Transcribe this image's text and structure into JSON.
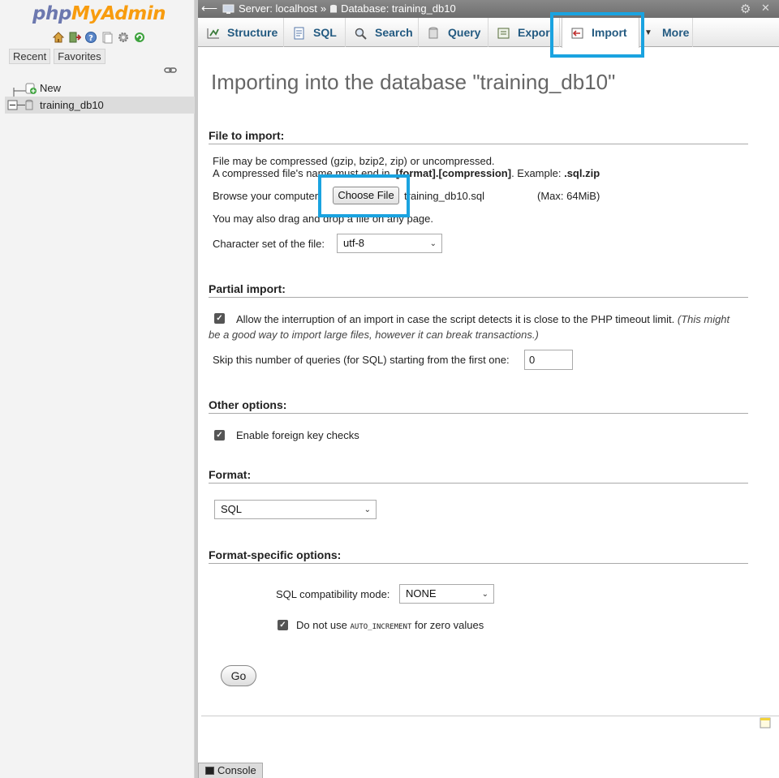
{
  "nav": {
    "logo": {
      "php": "php",
      "my": "My",
      "admin": "Admin"
    },
    "icons": [
      "home-icon",
      "logout-icon",
      "help-icon",
      "docs-icon",
      "settings-icon",
      "reload-icon"
    ],
    "tabs": [
      "Recent",
      "Favorites"
    ],
    "tree": [
      {
        "label": "New"
      },
      {
        "label": "training_db10"
      }
    ]
  },
  "breadcrumb": {
    "server": "Server: localhost",
    "separator": "»",
    "database": "Database: training_db10"
  },
  "menu": {
    "tabs": [
      {
        "label": "Structure",
        "icon": "structure-icon"
      },
      {
        "label": "SQL",
        "icon": "sql-icon"
      },
      {
        "label": "Search",
        "icon": "search-icon"
      },
      {
        "label": "Query",
        "icon": "query-icon"
      },
      {
        "label": "Expor",
        "icon": "export-icon"
      },
      {
        "label": "Import",
        "icon": "import-icon",
        "active": true
      },
      {
        "label": "More",
        "icon": "triangle-down-icon"
      }
    ]
  },
  "main": {
    "title": "Importing into the database \"training_db10\"",
    "file_section": {
      "heading": "File to import:",
      "line1": "File may be compressed (gzip, bzip2, zip) or uncompressed.",
      "line2_a": "A compressed file's name must end in ",
      "line2_b": ".[format].[compression]",
      "line2_c": ". Example: ",
      "line2_d": ".sql.zip",
      "browse_label": "Browse your computer:",
      "choose_file_button": "Choose File",
      "chosen_file": "training_db10.sql",
      "max_size": "(Max: 64MiB)",
      "drag_hint": "You may also drag and drop a file on any page.",
      "charset_label": "Character set of the file:",
      "charset_value": "utf-8"
    },
    "partial_section": {
      "heading": "Partial import:",
      "allow_interrupt_text": "Allow the interruption of an import in case the script detects it is close to the PHP timeout limit.",
      "allow_interrupt_note": "(This might be a good way to import large files, however it can break transactions.)",
      "allow_interrupt_checked": true,
      "skip_label": "Skip this number of queries (for SQL) starting from the first one:",
      "skip_value": "0"
    },
    "other_section": {
      "heading": "Other options:",
      "fk_label": "Enable foreign key checks",
      "fk_checked": true
    },
    "format_section": {
      "heading": "Format:",
      "format_value": "SQL"
    },
    "format_specific_section": {
      "heading": "Format-specific options:",
      "compat_label": "SQL compatibility mode:",
      "compat_value": "NONE",
      "auto_inc_a": "Do not use ",
      "auto_inc_b": "AUTO_INCREMENT",
      "auto_inc_c": " for zero values",
      "auto_inc_checked": true
    },
    "go_button": "Go"
  },
  "console": {
    "label": "Console"
  },
  "colors": {
    "highlight": "#1aa3e0",
    "tab_text": "#235a81",
    "logo_php": "#6c78af",
    "logo_myadmin": "#f89c0e"
  }
}
